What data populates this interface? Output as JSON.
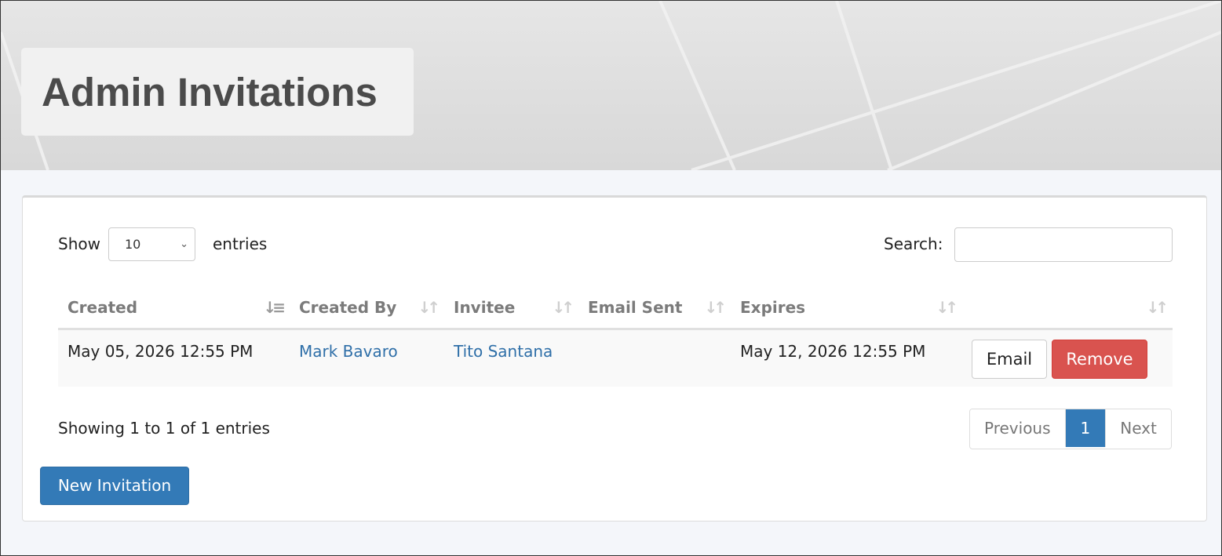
{
  "page": {
    "title": "Admin Invitations"
  },
  "controls": {
    "show_label": "Show",
    "page_size": "10",
    "entries_label": "entries",
    "search_label": "Search:",
    "search_value": ""
  },
  "table": {
    "columns": [
      "Created",
      "Created By",
      "Invitee",
      "Email Sent",
      "Expires",
      ""
    ],
    "rows": [
      {
        "created": "May 05, 2026 12:55 PM",
        "created_by": "Mark Bavaro",
        "invitee": "Tito Santana",
        "email_sent": "",
        "expires": "May 12, 2026 12:55 PM",
        "email_button": "Email",
        "remove_button": "Remove"
      }
    ]
  },
  "footer": {
    "info": "Showing 1 to 1 of 1 entries",
    "pagination": {
      "previous": "Previous",
      "current": "1",
      "next": "Next"
    },
    "new_button": "New Invitation"
  },
  "colors": {
    "primary": "#337ab7",
    "danger": "#d9534f",
    "link": "#2f6fa8",
    "background": "#f4f6fa"
  },
  "icons": {
    "sort_active": "sort-ascending-icon",
    "sort_default": "sort-both-icon",
    "dropdown": "chevron-down-icon"
  }
}
